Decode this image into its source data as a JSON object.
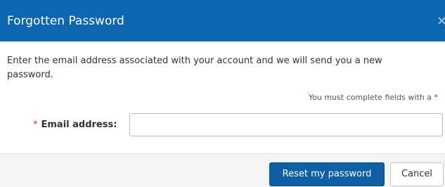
{
  "dialog": {
    "title": "Forgotten Password",
    "close_glyph": "×"
  },
  "body": {
    "intro_text": "Enter the email address associated with your account and we will send you a new password.",
    "required_note": "You must complete fields with a",
    "required_marker": "*"
  },
  "form": {
    "email_label": "Email address:",
    "email_required_marker": "*",
    "email_value": "",
    "email_placeholder": ""
  },
  "footer": {
    "submit_label": "Reset my password",
    "cancel_label": "Cancel"
  },
  "colors": {
    "header_background": "#0d66b0",
    "primary_button": "#0d5fa6",
    "required_marker": "#c9302c",
    "footer_background": "#f5f5f5"
  },
  "icons": {
    "close": "close-icon"
  }
}
